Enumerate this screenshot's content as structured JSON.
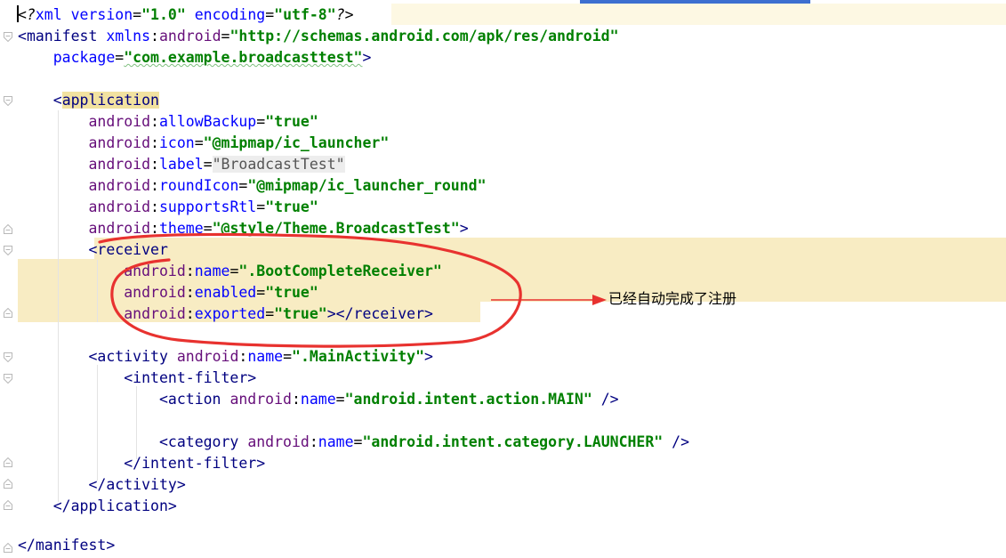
{
  "code": {
    "xml_decl": {
      "open": "<?",
      "name": "xml",
      "a1": "version",
      "v1": "\"1.0\"",
      "a2": "encoding",
      "v2": "\"utf-8\"",
      "close": "?>"
    },
    "manifest_open": {
      "bracket": "<",
      "tag": "manifest",
      "xmlns_prefix": "xmlns",
      "xmlns_attr": "android",
      "xmlns_value": "\"http://schemas.android.com/apk/res/android\"",
      "package_attr": "package",
      "package_value": "\"com.example.broadcasttest\"",
      "close": ">"
    },
    "application_open": {
      "bracket": "<",
      "tag": "application"
    },
    "ns": "android",
    "app_attrs": [
      {
        "name": "allowBackup",
        "value": "\"true\""
      },
      {
        "name": "icon",
        "value": "\"@mipmap/ic_launcher\""
      },
      {
        "name": "label",
        "value": "\"BroadcastTest\""
      },
      {
        "name": "roundIcon",
        "value": "\"@mipmap/ic_launcher_round\""
      },
      {
        "name": "supportsRtl",
        "value": "\"true\""
      },
      {
        "name": "theme",
        "value": "\"@style/Theme.BroadcastTest\""
      }
    ],
    "gt": ">",
    "receiver": {
      "open_tag": "receiver",
      "attrs": [
        {
          "name": "name",
          "value": "\".BootCompleteReceiver\""
        },
        {
          "name": "enabled",
          "value": "\"true\""
        },
        {
          "name": "exported",
          "value": "\"true\""
        }
      ],
      "close_tag": "></receiver>"
    },
    "activity": {
      "tag": "activity",
      "attr": "name",
      "value": "\".MainActivity\"",
      "close": "</activity>"
    },
    "intent_filter": {
      "open": "<intent-filter>",
      "close": "</intent-filter>"
    },
    "action": {
      "tag": "action",
      "attr": "name",
      "value": "\"android.intent.action.MAIN\"",
      "end": " />"
    },
    "category": {
      "tag": "category",
      "attr": "name",
      "value": "\"android.intent.category.LAUNCHER\"",
      "end": " />"
    },
    "application_close": "</application>",
    "manifest_close": "</manifest>"
  },
  "annotation": {
    "text": "已经自动完成了注册",
    "color": "#e8322f"
  },
  "colors": {
    "tag": "#000080",
    "attribute": "#0000ff",
    "namespace": "#660e7a",
    "value": "#008000",
    "highlight": "#f8ecc3",
    "accent": "#3d6fd0"
  }
}
